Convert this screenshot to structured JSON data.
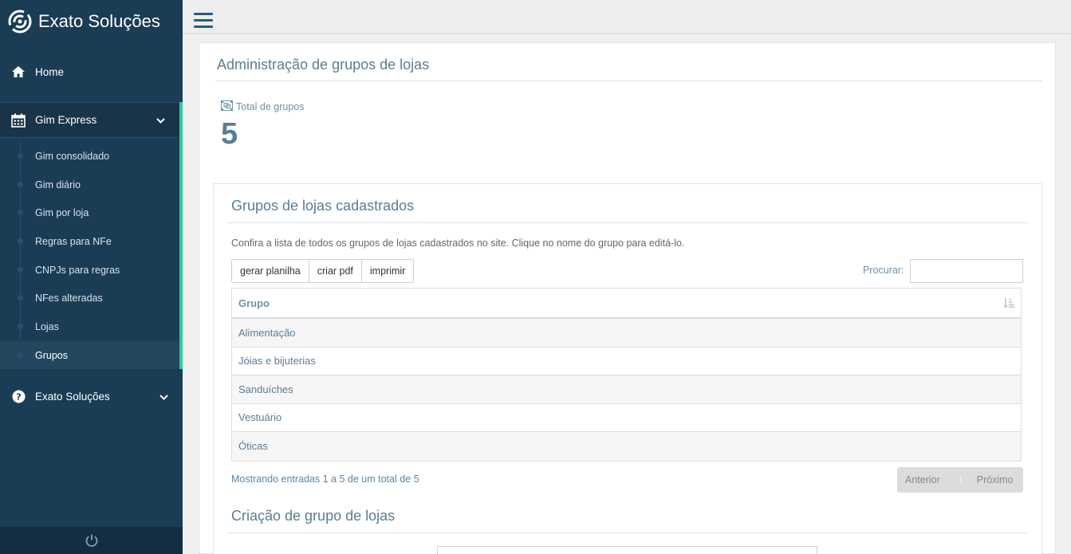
{
  "brand": {
    "name": "Exato Soluções"
  },
  "sidebar": {
    "home": {
      "label": "Home",
      "icon": "home-icon"
    },
    "gim_express": {
      "label": "Gim Express",
      "icon": "calendar-icon",
      "items": [
        {
          "label": "Gim consolidado"
        },
        {
          "label": "Gim diário"
        },
        {
          "label": "Gim por loja"
        },
        {
          "label": "Regras para NFe"
        },
        {
          "label": "CNPJs para regras"
        },
        {
          "label": "NFes alteradas"
        },
        {
          "label": "Lojas"
        },
        {
          "label": "Grupos",
          "active": true
        }
      ]
    },
    "exato": {
      "label": "Exato Soluções",
      "icon": "question-circle-icon"
    },
    "footer_icon": "power-icon"
  },
  "colors": {
    "sidebar_bg": "#1b3c55",
    "accent": "#2ecc9b",
    "title": "#5a7d96"
  },
  "page": {
    "title": "Administração de grupos de lojas",
    "stat": {
      "label": "Total de grupos",
      "value": "5"
    }
  },
  "list_card": {
    "title": "Grupos de lojas cadastrados",
    "description": "Confira a lista de todos os grupos de lojas cadastrados no site. Clique no nome do grupo para editá-lo.",
    "buttons": {
      "excel": "gerar planilha",
      "pdf": "criar pdf",
      "print": "imprimir"
    },
    "search_label": "Procurar:",
    "search_value": "",
    "table": {
      "header": "Grupo",
      "rows": [
        "Alimentação",
        "Jóias e bijuterias",
        "Sanduíches",
        "Vestuário",
        "Óticas"
      ]
    },
    "info": "Mostrando entradas 1 a 5 de um total de 5",
    "pagination": {
      "prev": "Anterior",
      "page": "1",
      "next": "Próximo"
    }
  },
  "create_card": {
    "title": "Criação de grupo de lojas"
  }
}
